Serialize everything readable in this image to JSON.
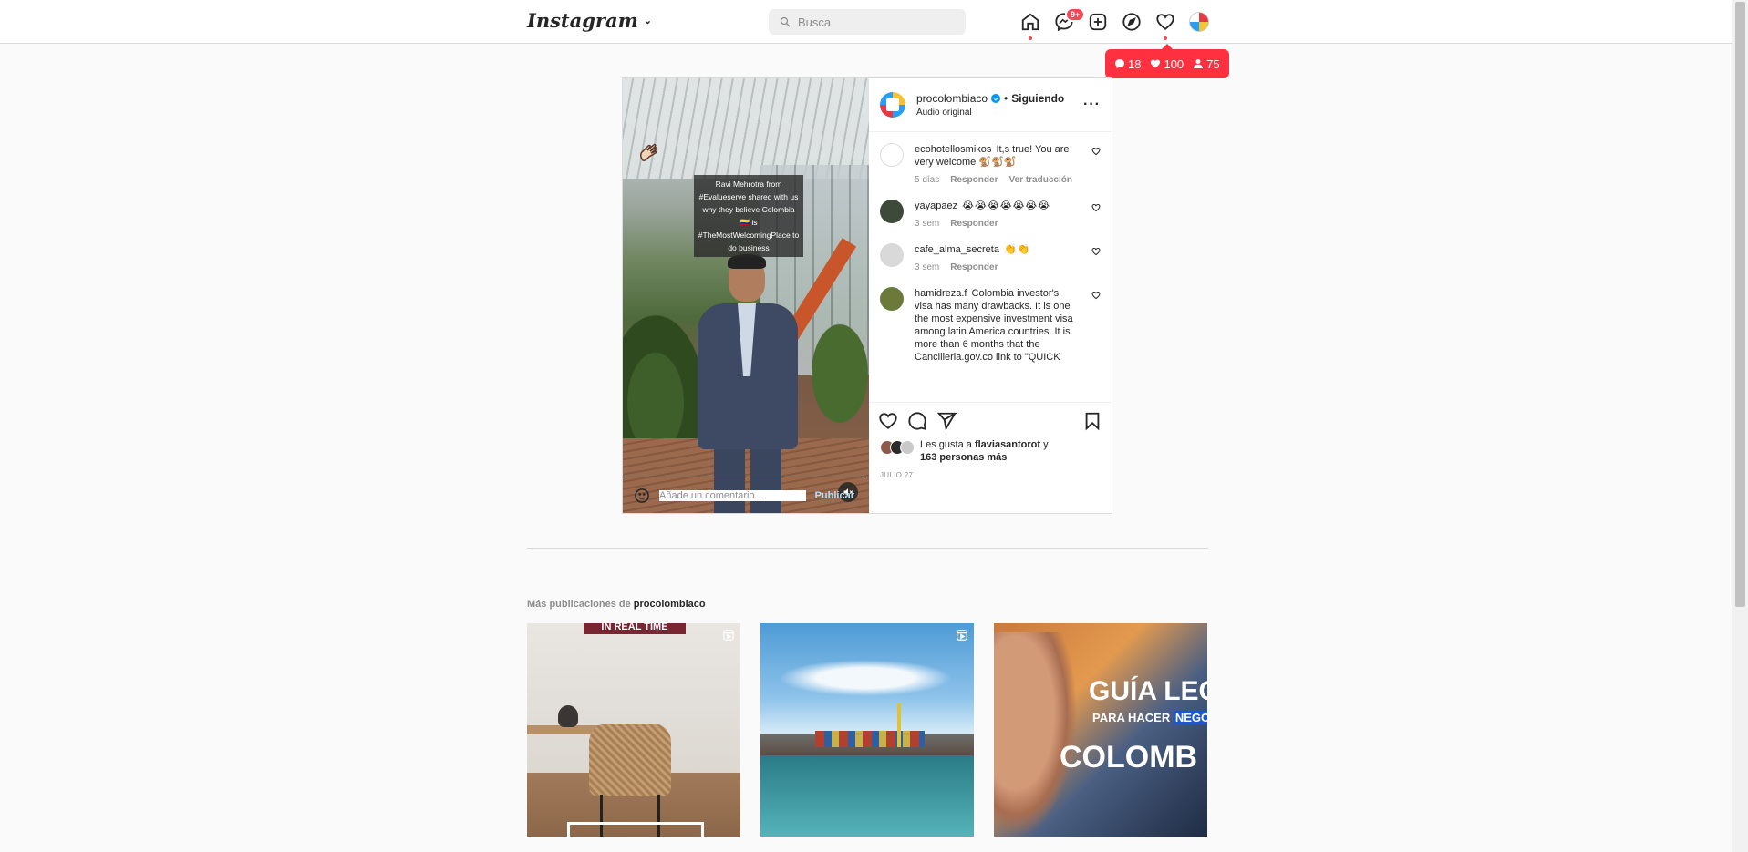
{
  "header": {
    "logo": "Instagram",
    "search_placeholder": "Busca",
    "messages_badge": "9+"
  },
  "notifications": {
    "comments": "18",
    "likes": "100",
    "follows": "75"
  },
  "post": {
    "account": "procolombiaco",
    "separator": "•",
    "following": "Siguiendo",
    "audio": "Audio original",
    "video_caption": "Ravi Mehrotra from #Evalueserve shared with us why they believe Colombia 🇨🇴 is #TheMostWelcomingPlace to do business",
    "comments": [
      {
        "user": "ecohotellosmikos",
        "text": "It,s true! You are very welcome 🐒🐒🐒",
        "time": "5 días",
        "reply": "Responder",
        "translate": "Ver traducción",
        "avatar_color": "#ffffff"
      },
      {
        "user": "yayapaez",
        "text": "😭😭😭😭😭😭😭",
        "time": "3 sem",
        "reply": "Responder",
        "translate": "",
        "avatar_color": "#3d4a3a"
      },
      {
        "user": "cafe_alma_secreta",
        "text": "👏👏",
        "time": "3 sem",
        "reply": "Responder",
        "translate": "",
        "avatar_color": "#d9d9d9"
      },
      {
        "user": "hamidreza.f",
        "text": "Colombia investor's visa has many drawbacks. It is one the most expensive investment visa among latin America countries. It is more than 6 months that the Cancilleria.gov.co link to \"QUICK",
        "time": "",
        "reply": "",
        "translate": "",
        "avatar_color": "#6b7a3b"
      }
    ],
    "likes_prefix": "Les gusta a",
    "likes_user": "flaviasantorot",
    "likes_conj": "y",
    "likes_count": "163 personas más",
    "date": "JULIO 27",
    "comment_placeholder": "Añade un comentario...",
    "publish_label": "Publicar"
  },
  "more_posts": {
    "prefix": "Más publicaciones de",
    "account": "procolombiaco",
    "tiles": [
      {
        "text": "IN REAL TIME"
      },
      {
        "text": ""
      },
      {
        "text_line1": "GUÍA LEG",
        "text_line2a": "PARA HACER",
        "text_line2b": "NEGOC",
        "text_line3": "COLOMB"
      }
    ]
  }
}
